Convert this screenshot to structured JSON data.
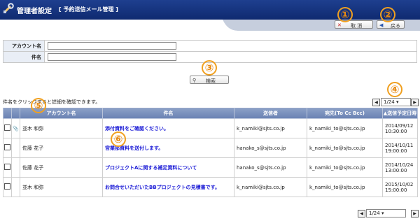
{
  "header": {
    "title": "管理者設定",
    "subtitle": "[ 予約送信メール管理 ]"
  },
  "toolbar": {
    "cancel_label": "取 消",
    "back_label": "戻る"
  },
  "form": {
    "account_label": "アカウント名",
    "account_value": "",
    "subject_label": "件名",
    "subject_value": ""
  },
  "search": {
    "button_label": "検索"
  },
  "hint": "件名をクリックすると詳細を確認できます。",
  "pager": {
    "current": "1/24"
  },
  "table": {
    "headers": {
      "account": "アカウント名",
      "subject": "件名",
      "sender": "送信者",
      "recipient": "宛先(To Cc Bcc)",
      "scheduled": "▲送信予定日時"
    },
    "rows": [
      {
        "attachment": true,
        "account": "並木 和弥",
        "subject": "添付資料をご確認ください。",
        "sender": "k_namiki@sjts.co.jp",
        "recipient": "k_namiki_to@sjts.co.jp",
        "date": "2014/09/12",
        "time": "10:30:00"
      },
      {
        "attachment": false,
        "account": "佐藤 花子",
        "subject": "営業部資料を送付します。",
        "sender": "hanako_s@sjts.co.jp",
        "recipient": "k_namiki_to@sjts.co.jp",
        "date": "2014/10/11",
        "time": "19:00:00"
      },
      {
        "attachment": false,
        "account": "佐藤 花子",
        "subject": "プロジェクトAに関する補足資料について",
        "sender": "hanako_s@sjts.co.jp",
        "recipient": "k_namiki_to@sjts.co.jp",
        "date": "2014/10/24",
        "time": "13:00:00"
      },
      {
        "attachment": false,
        "account": "並木 和弥",
        "subject": "お問合せいただいたBBプロジェクトの見積書です。",
        "sender": "k_namiki@sjts.co.jp",
        "recipient": "k_namiki_to@sjts.co.jp",
        "date": "2015/10/02",
        "time": "15:00:00"
      }
    ]
  },
  "markers": [
    "①",
    "②",
    "③",
    "④",
    "⑤",
    "⑥"
  ],
  "colors": {
    "header": "#1e3f8f",
    "marker": "#f0a020",
    "link": "#1a1ad6",
    "grid_header": "#7a90bd"
  },
  "icons": {
    "header": "wrench-icon",
    "cancel": "close-icon",
    "back": "back-arrow-icon",
    "search": "search-icon",
    "attachment": "paperclip-icon"
  }
}
